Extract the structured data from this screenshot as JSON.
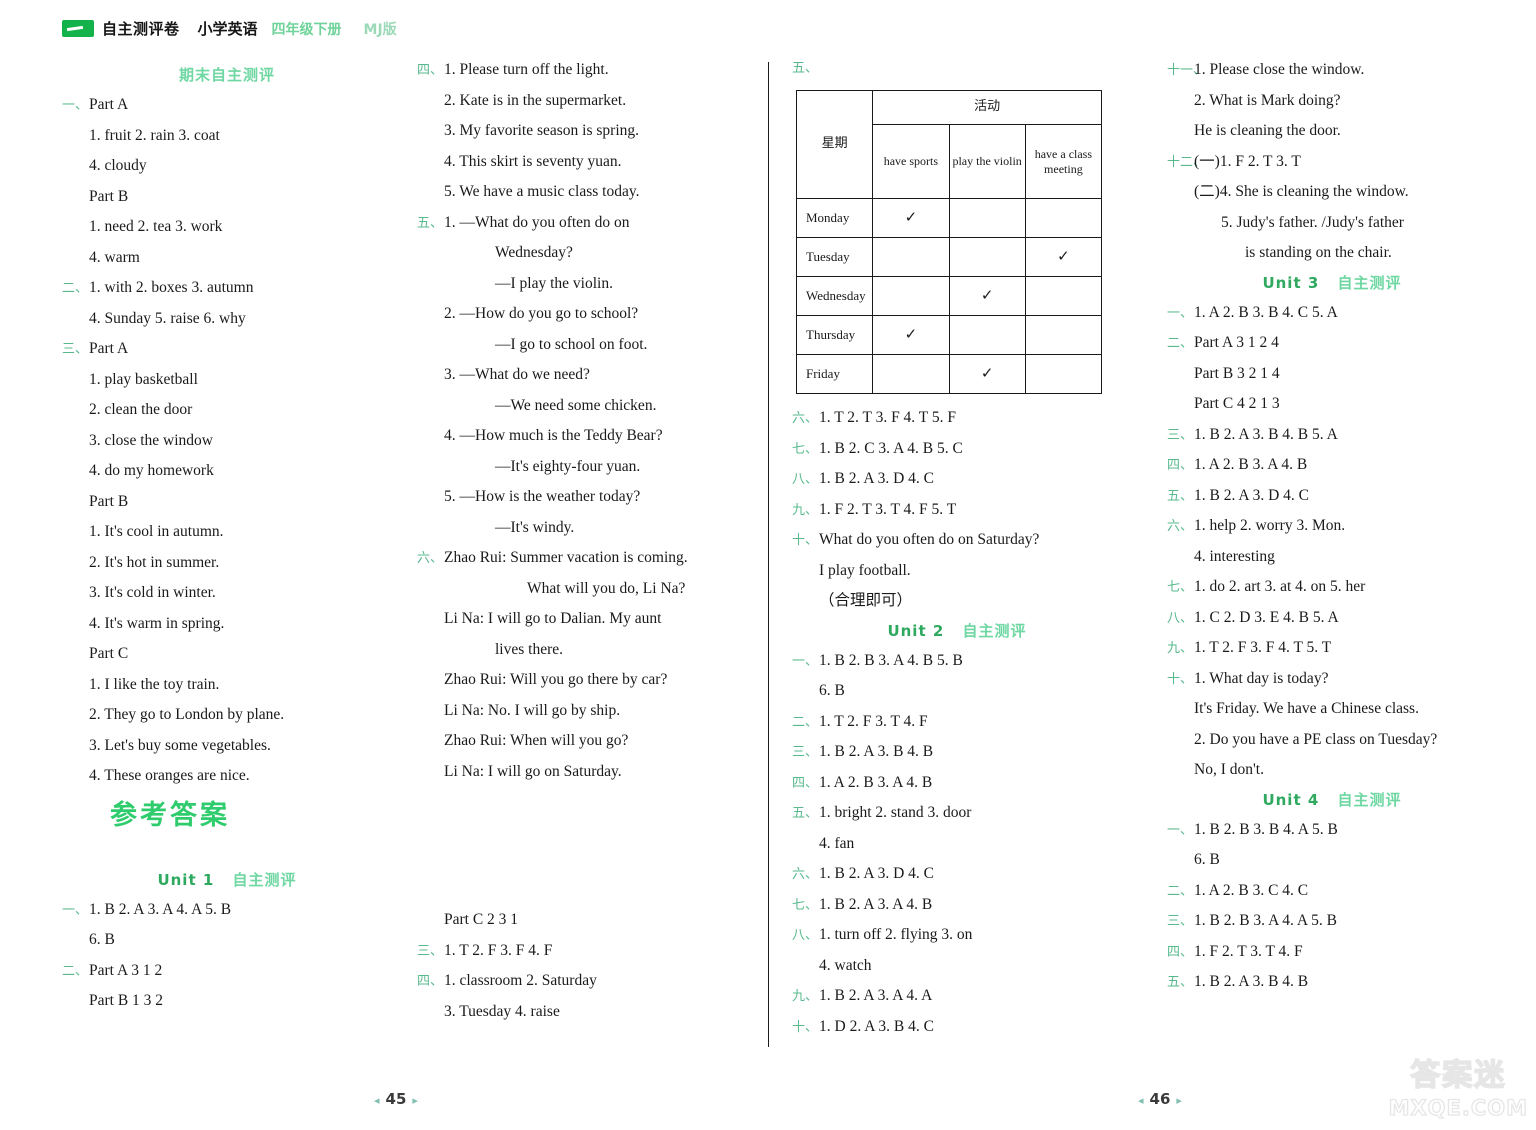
{
  "masthead": {
    "brand": "自主测评卷",
    "subject": "小学英语",
    "grade": "四年级下册",
    "edition": "MJ版"
  },
  "col1": {
    "section_title": "期末自主测评",
    "lines": [
      {
        "marker": "一、",
        "indent": 0,
        "text": "Part A"
      },
      {
        "marker": "",
        "indent": 1,
        "text": "1. fruit   2. rain   3. coat"
      },
      {
        "marker": "",
        "indent": 1,
        "text": "4. cloudy"
      },
      {
        "marker": "",
        "indent": 0,
        "text": "Part B"
      },
      {
        "marker": "",
        "indent": 1,
        "text": "1. need   2. tea   3. work"
      },
      {
        "marker": "",
        "indent": 1,
        "text": "4. warm"
      },
      {
        "marker": "二、",
        "indent": 0,
        "text": "1. with   2. boxes   3. autumn"
      },
      {
        "marker": "",
        "indent": 1,
        "text": "4. Sunday   5. raise   6. why"
      },
      {
        "marker": "三、",
        "indent": 0,
        "text": "Part A"
      },
      {
        "marker": "",
        "indent": 1,
        "text": "1.  play basketball"
      },
      {
        "marker": "",
        "indent": 1,
        "text": "2.  clean the door"
      },
      {
        "marker": "",
        "indent": 1,
        "text": "3.  close the window"
      },
      {
        "marker": "",
        "indent": 1,
        "text": "4.  do my homework"
      },
      {
        "marker": "",
        "indent": 0,
        "text": "Part B"
      },
      {
        "marker": "",
        "indent": 1,
        "text": "1.  It's cool in autumn."
      },
      {
        "marker": "",
        "indent": 1,
        "text": "2.  It's hot in summer."
      },
      {
        "marker": "",
        "indent": 1,
        "text": "3.  It's cold in winter."
      },
      {
        "marker": "",
        "indent": 1,
        "text": "4.  It's warm in spring."
      },
      {
        "marker": "",
        "indent": 0,
        "text": "Part C"
      },
      {
        "marker": "",
        "indent": 1,
        "text": "1.  I like the toy train."
      },
      {
        "marker": "",
        "indent": 1,
        "text": "2.  They go to London by plane."
      },
      {
        "marker": "",
        "indent": 1,
        "text": "3.  Let's buy some vegetables."
      },
      {
        "marker": "",
        "indent": 1,
        "text": "4.  These oranges are nice."
      }
    ],
    "answers_banner": "参考答案",
    "unit1_banner": {
      "unit": "Unit 1",
      "cn": "自主测评"
    },
    "unit1_lines": [
      {
        "marker": "一、",
        "indent": 0,
        "text": "1. B   2. A   3. A   4. A   5. B"
      },
      {
        "marker": "",
        "indent": 1,
        "text": "6. B"
      },
      {
        "marker": "二、",
        "indent": 0,
        "text": "Part A   3 1 2"
      },
      {
        "marker": "",
        "indent": 1,
        "text": "Part B   1 3 2"
      }
    ]
  },
  "col2": {
    "lines": [
      {
        "marker": "四、",
        "indent": 0,
        "text": "1.  Please turn off the light."
      },
      {
        "marker": "",
        "indent": 1,
        "text": "2.  Kate is in the supermarket."
      },
      {
        "marker": "",
        "indent": 1,
        "text": "3.  My favorite season is spring."
      },
      {
        "marker": "",
        "indent": 1,
        "text": "4.  This skirt is seventy yuan."
      },
      {
        "marker": "",
        "indent": 1,
        "text": "5.  We have a music class today."
      },
      {
        "marker": "五、",
        "indent": 0,
        "text": "1.  —What  do  you  often  do  on"
      },
      {
        "marker": "",
        "indent": 3,
        "text": "Wednesday?"
      },
      {
        "marker": "",
        "indent": 3,
        "text": "—I play the violin."
      },
      {
        "marker": "",
        "indent": 1,
        "text": "2.  —How do you go to school?"
      },
      {
        "marker": "",
        "indent": 3,
        "text": "—I go to school on foot."
      },
      {
        "marker": "",
        "indent": 1,
        "text": "3.  —What do we need?"
      },
      {
        "marker": "",
        "indent": 3,
        "text": "—We need some chicken."
      },
      {
        "marker": "",
        "indent": 1,
        "text": "4.  —How much is the Teddy Bear?"
      },
      {
        "marker": "",
        "indent": 3,
        "text": "—It's eighty-four yuan."
      },
      {
        "marker": "",
        "indent": 1,
        "text": "5.  —How is the weather today?"
      },
      {
        "marker": "",
        "indent": 3,
        "text": "—It's windy."
      },
      {
        "marker": "六、",
        "indent": 0,
        "text": "Zhao Rui: Summer vacation is coming."
      },
      {
        "marker": "",
        "indent": 4,
        "text": "What will you do, Li Na?"
      },
      {
        "marker": "",
        "indent": 1,
        "text": "Li Na: I  will  go  to  Dalian.  My  aunt"
      },
      {
        "marker": "",
        "indent": 3,
        "text": "lives there."
      },
      {
        "marker": "",
        "indent": 0,
        "text": "Zhao Rui: Will you go there by car?"
      },
      {
        "marker": "",
        "indent": 1,
        "text": "Li Na: No. I will go by ship."
      },
      {
        "marker": "",
        "indent": 0,
        "text": "Zhao Rui: When will you go?"
      },
      {
        "marker": "",
        "indent": 1,
        "text": "Li Na: I will go on Saturday."
      }
    ],
    "unit1_cont": [
      {
        "marker": "",
        "indent": 1,
        "text": "Part C   2 3 1"
      },
      {
        "marker": "三、",
        "indent": 0,
        "text": "1. T   2. F   3. F   4. F"
      },
      {
        "marker": "四、",
        "indent": 0,
        "text": "1. classroom   2. Saturday"
      },
      {
        "marker": "",
        "indent": 1,
        "text": "3. Tuesday   4. raise"
      }
    ]
  },
  "col3": {
    "table_marker": "五、",
    "table": {
      "activity_header": "活动",
      "day_header": "星期",
      "columns": [
        "have sports",
        "play the violin",
        "have a class meeting"
      ],
      "rows": [
        {
          "day": "Monday",
          "checks": [
            true,
            false,
            false
          ]
        },
        {
          "day": "Tuesday",
          "checks": [
            false,
            false,
            true
          ]
        },
        {
          "day": "Wednesday",
          "checks": [
            false,
            true,
            false
          ]
        },
        {
          "day": "Thursday",
          "checks": [
            true,
            false,
            false
          ]
        },
        {
          "day": "Friday",
          "checks": [
            false,
            true,
            false
          ]
        }
      ],
      "check_glyph": "✓"
    },
    "lines": [
      {
        "marker": "六、",
        "indent": 0,
        "text": "1. T   2. T   3. F   4. T   5. F"
      },
      {
        "marker": "七、",
        "indent": 0,
        "text": "1. B   2. C   3. A   4. B   5. C"
      },
      {
        "marker": "八、",
        "indent": 0,
        "text": "1. B   2. A   3. D   4. C"
      },
      {
        "marker": "九、",
        "indent": 0,
        "text": "1. F   2. T   3. T   4. F   5. T"
      },
      {
        "marker": "十、",
        "indent": 0,
        "text": "What do you often do on Saturday?"
      },
      {
        "marker": "",
        "indent": 1,
        "text": "I play football."
      },
      {
        "marker": "",
        "indent": 1,
        "text": "（合理即可）"
      }
    ],
    "unit2_banner": {
      "unit": "Unit 2",
      "cn": "自主测评"
    },
    "unit2_lines": [
      {
        "marker": "一、",
        "indent": 0,
        "text": "1. B   2. B   3. A   4. B   5. B"
      },
      {
        "marker": "",
        "indent": 1,
        "text": "6. B"
      },
      {
        "marker": "二、",
        "indent": 0,
        "text": "1. T   2. F   3. T   4. F"
      },
      {
        "marker": "三、",
        "indent": 0,
        "text": "1. B   2. A   3. B   4. B"
      },
      {
        "marker": "四、",
        "indent": 0,
        "text": "1. A   2. B   3. A   4. B"
      },
      {
        "marker": "五、",
        "indent": 0,
        "text": "1. bright   2. stand   3. door"
      },
      {
        "marker": "",
        "indent": 1,
        "text": "4. fan"
      },
      {
        "marker": "六、",
        "indent": 0,
        "text": "1. B   2. A   3. D   4. C"
      },
      {
        "marker": "七、",
        "indent": 0,
        "text": "1. B   2. A   3. A   4. B"
      },
      {
        "marker": "八、",
        "indent": 0,
        "text": "1. turn off   2. flying   3. on"
      },
      {
        "marker": "",
        "indent": 1,
        "text": "4. watch"
      },
      {
        "marker": "九、",
        "indent": 0,
        "text": "1. B   2. A   3. A   4. A"
      },
      {
        "marker": "十、",
        "indent": 0,
        "text": "1. D   2. A   3. B   4. C"
      }
    ]
  },
  "col4": {
    "lines": [
      {
        "marker": "十一、",
        "indent": 0,
        "text": "1.  Please close the window."
      },
      {
        "marker": "",
        "indent": 1,
        "text": "2.  What is Mark doing?"
      },
      {
        "marker": "",
        "indent": 1,
        "text": "He is cleaning the door."
      },
      {
        "marker": "十二、",
        "indent": 0,
        "text": "(一)1.  F   2.  T   3.  T"
      },
      {
        "marker": "",
        "indent": 1,
        "text": "(二)4.  She is cleaning the window."
      },
      {
        "marker": "",
        "indent": 2,
        "text": "5.  Judy's father. /Judy's father"
      },
      {
        "marker": "",
        "indent": 3,
        "text": "is standing on the chair."
      }
    ],
    "unit3_banner": {
      "unit": "Unit 3",
      "cn": "自主测评"
    },
    "unit3_lines": [
      {
        "marker": "一、",
        "indent": 0,
        "text": "1. A   2. B   3. B   4. C   5. A"
      },
      {
        "marker": "二、",
        "indent": 0,
        "text": "Part A   3 1 2 4"
      },
      {
        "marker": "",
        "indent": 1,
        "text": "Part B   3 2 1 4"
      },
      {
        "marker": "",
        "indent": 1,
        "text": "Part C   4 2 1 3"
      },
      {
        "marker": "三、",
        "indent": 0,
        "text": "1. B   2. A   3. B   4. B   5. A"
      },
      {
        "marker": "四、",
        "indent": 0,
        "text": "1. A   2. B   3. A   4. B"
      },
      {
        "marker": "五、",
        "indent": 0,
        "text": "1. B   2. A   3. D   4. C"
      },
      {
        "marker": "六、",
        "indent": 0,
        "text": "1. help   2. worry   3. Mon."
      },
      {
        "marker": "",
        "indent": 1,
        "text": "4. interesting"
      },
      {
        "marker": "七、",
        "indent": 0,
        "text": "1. do   2. art   3. at   4. on   5. her"
      },
      {
        "marker": "八、",
        "indent": 0,
        "text": "1. C   2. D   3. E   4. B   5. A"
      },
      {
        "marker": "九、",
        "indent": 0,
        "text": "1. T   2. F   3. F   4. T   5. T"
      },
      {
        "marker": "十、",
        "indent": 0,
        "text": "1.  What day is today?"
      },
      {
        "marker": "",
        "indent": 1,
        "text": "It's Friday. We have a Chinese class."
      },
      {
        "marker": "",
        "indent": 1,
        "text": "2.  Do you have a PE class on Tuesday?"
      },
      {
        "marker": "",
        "indent": 1,
        "text": "No, I don't."
      }
    ],
    "unit4_banner": {
      "unit": "Unit 4",
      "cn": "自主测评"
    },
    "unit4_lines": [
      {
        "marker": "一、",
        "indent": 0,
        "text": "1. B   2. B   3. B   4. A   5. B"
      },
      {
        "marker": "",
        "indent": 1,
        "text": "6. B"
      },
      {
        "marker": "二、",
        "indent": 0,
        "text": "1. A   2. B   3. C   4. C"
      },
      {
        "marker": "三、",
        "indent": 0,
        "text": "1. B   2. B   3. A   4. A   5. B"
      },
      {
        "marker": "四、",
        "indent": 0,
        "text": "1. F   2. T   3. T   4. F"
      },
      {
        "marker": "五、",
        "indent": 0,
        "text": "1. B   2. A   3. B   4. B"
      }
    ]
  },
  "footer": {
    "left_page": "45",
    "right_page": "46"
  },
  "watermark": {
    "cn": "答案迷",
    "en": "MXQE.COM"
  }
}
